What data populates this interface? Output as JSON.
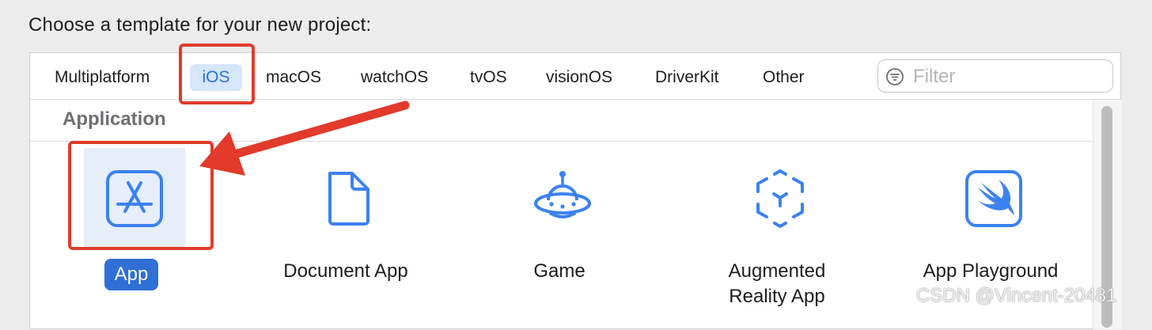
{
  "dialog": {
    "prompt": "Choose a template for your new project:"
  },
  "tabs": [
    {
      "label": "Multiplatform",
      "selected": false
    },
    {
      "label": "iOS",
      "selected": true
    },
    {
      "label": "macOS",
      "selected": false
    },
    {
      "label": "watchOS",
      "selected": false
    },
    {
      "label": "tvOS",
      "selected": false
    },
    {
      "label": "visionOS",
      "selected": false
    },
    {
      "label": "DriverKit",
      "selected": false
    },
    {
      "label": "Other",
      "selected": false
    }
  ],
  "filter": {
    "placeholder": "Filter",
    "icon": "filter-icon"
  },
  "section": {
    "title": "Application"
  },
  "templates": [
    {
      "label": "App",
      "icon": "app-store-icon",
      "selected": true
    },
    {
      "label": "Document App",
      "icon": "document-icon",
      "selected": false
    },
    {
      "label": "Game",
      "icon": "ufo-icon",
      "selected": false
    },
    {
      "label": "Augmented Reality App",
      "icon": "ar-cube-icon",
      "selected": false
    },
    {
      "label": "App Playground",
      "icon": "swift-icon",
      "selected": false
    }
  ],
  "colors": {
    "accent": "#2f6fd6",
    "icon_blue": "#3b82f0",
    "annotation_red": "#e23a2b"
  },
  "watermark": "CSDN @Vincent-20481"
}
